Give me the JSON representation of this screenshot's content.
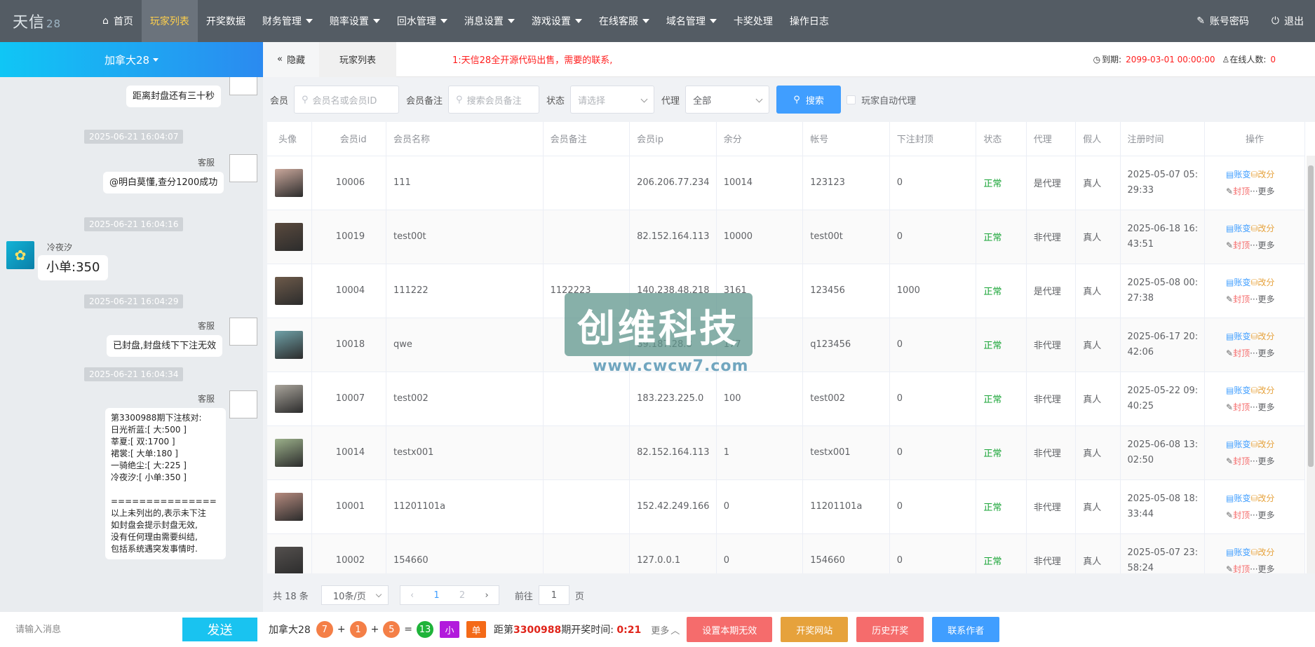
{
  "nav": {
    "logo_main": "天信",
    "logo_num": "28",
    "items": [
      {
        "label": "首页",
        "icon": "home-icon"
      },
      {
        "label": "玩家列表",
        "active": true
      },
      {
        "label": "开奖数据"
      },
      {
        "label": "财务管理",
        "dropdown": true
      },
      {
        "label": "赔率设置",
        "dropdown": true
      },
      {
        "label": "回水管理",
        "dropdown": true
      },
      {
        "label": "消息设置",
        "dropdown": true
      },
      {
        "label": "游戏设置",
        "dropdown": true
      },
      {
        "label": "在线客服",
        "dropdown": true
      },
      {
        "label": "域名管理",
        "dropdown": true
      },
      {
        "label": "卡奖处理"
      },
      {
        "label": "操作日志"
      }
    ],
    "account_label": "账号密码",
    "logout_label": "退出"
  },
  "chat": {
    "room": "加拿大28",
    "messages": [
      {
        "type": "bubble",
        "sender": "",
        "text": "距离封盘还有三十秒"
      },
      {
        "type": "time",
        "text": "2025-06-21 16:04:07"
      },
      {
        "type": "msg",
        "sender": "客服",
        "text": "@明白莫懂,查分1200成功"
      },
      {
        "type": "time",
        "text": "2025-06-21 16:04:16"
      },
      {
        "type": "msg",
        "sender": "冷夜汐",
        "text": "小单:350"
      },
      {
        "type": "time",
        "text": "2025-06-21 16:04:29"
      },
      {
        "type": "msg",
        "sender": "客服",
        "text": "已封盘,封盘线下下注无效"
      },
      {
        "type": "time",
        "text": "2025-06-21 16:04:34"
      },
      {
        "type": "msg",
        "sender": "客服",
        "text": "第3300988期下注核对:\n日光祈蓝:[ 大:500 ]\n莘夏:[ 双:1700 ]\n裙裳:[ 大单:180 ]\n一骑绝尘:[ 大:225 ]\n冷夜汐:[ 小单:350 ]\n\n===============\n以上未列出的,表示未下注\n如封盘会提示封盘无效,\n没有任何理由需要纠结,\n包括系统遇突发事情时."
      }
    ],
    "input_placeholder": "请输入消息",
    "send_label": "发送"
  },
  "tabs": {
    "hide_label": "隐藏",
    "current_tab": "玩家列表",
    "notice": "1:天信28全开源代码出售，需要的联系,",
    "expire_label": "到期:",
    "expire_value": "2099-03-01 00:00:00",
    "online_label": "在线人数:",
    "online_value": "0"
  },
  "filters": {
    "member_label": "会员",
    "member_placeholder": "会员名或会员ID",
    "remark_label": "会员备注",
    "remark_placeholder": "搜索会员备注",
    "status_label": "状态",
    "status_placeholder": "请选择",
    "agent_label": "代理",
    "agent_value": "全部",
    "search_label": "搜索",
    "auto_agent_label": "玩家自动代理"
  },
  "table": {
    "headers": [
      "头像",
      "会员id",
      "会员名称",
      "会员备注",
      "会员ip",
      "余分",
      "帐号",
      "下注封顶",
      "状态",
      "代理",
      "假人",
      "注册时间",
      "操作"
    ],
    "rows": [
      {
        "id": "10006",
        "name": "111",
        "remark": "",
        "ip": "206.206.77.234",
        "balance": "10014",
        "account": "123123",
        "cap": "0",
        "status": "正常",
        "agent": "是代理",
        "fake": "真人",
        "reg1": "2025-05-07 05:",
        "reg2": "29:33",
        "color": "#c9a79b"
      },
      {
        "id": "10019",
        "name": "test00t",
        "remark": "",
        "ip": "82.152.164.113",
        "balance": "10000",
        "account": "test00t",
        "cap": "0",
        "status": "正常",
        "agent": "非代理",
        "fake": "真人",
        "reg1": "2025-06-18 16:",
        "reg2": "43:51",
        "color": "#5a4a3e"
      },
      {
        "id": "10004",
        "name": "111222",
        "remark": "1122223",
        "ip": "140.238.48.218",
        "balance": "3161",
        "account": "123456",
        "cap": "1000",
        "status": "正常",
        "agent": "是代理",
        "fake": "真人",
        "reg1": "2025-05-08 00:",
        "reg2": "27:38",
        "color": "#6d5a4a"
      },
      {
        "id": "10018",
        "name": "qwe",
        "remark": "",
        "ip": "89.187.28.8",
        "balance": "177",
        "account": "q123456",
        "cap": "0",
        "status": "正常",
        "agent": "非代理",
        "fake": "真人",
        "reg1": "2025-06-17 20:",
        "reg2": "42:06",
        "color": "#6fa1a8"
      },
      {
        "id": "10007",
        "name": "test002",
        "remark": "",
        "ip": "183.223.225.0",
        "balance": "100",
        "account": "test002",
        "cap": "0",
        "status": "正常",
        "agent": "非代理",
        "fake": "真人",
        "reg1": "2025-05-22 09:",
        "reg2": "40:25",
        "color": "#a9a49b"
      },
      {
        "id": "10014",
        "name": "testx001",
        "remark": "",
        "ip": "82.152.164.113",
        "balance": "1",
        "account": "testx001",
        "cap": "0",
        "status": "正常",
        "agent": "非代理",
        "fake": "真人",
        "reg1": "2025-06-08 13:",
        "reg2": "02:50",
        "color": "#9bb08a"
      },
      {
        "id": "10001",
        "name": "11201101a",
        "remark": "",
        "ip": "152.42.249.166",
        "balance": "0",
        "account": "11201101a",
        "cap": "0",
        "status": "正常",
        "agent": "非代理",
        "fake": "真人",
        "reg1": "2025-05-08 18:",
        "reg2": "33:44",
        "color": "#b58a7e"
      },
      {
        "id": "10002",
        "name": "154660",
        "remark": "",
        "ip": "127.0.0.1",
        "balance": "0",
        "account": "154660",
        "cap": "0",
        "status": "正常",
        "agent": "非代理",
        "fake": "真人",
        "reg1": "2025-05-07 23:",
        "reg2": "58:24",
        "color": "#54504e"
      }
    ],
    "op_account": "账变",
    "op_score": "改分",
    "op_block": "封顶",
    "op_more": "更多"
  },
  "watermark": {
    "text": "创维科技",
    "url": "www.cwcw7.com"
  },
  "pager": {
    "total": "共 18 条",
    "page_size": "10条/页",
    "current": "1",
    "next_page": "2",
    "goto_label": "前往",
    "goto_value": "1",
    "page_suffix": "页"
  },
  "bottom": {
    "game": "加拿大28",
    "n1": "7",
    "n2": "1",
    "n3": "5",
    "sum": "13",
    "size": "小",
    "parity": "单",
    "prefix": "距第",
    "period": "3300988",
    "suffix": "期开奖时间:",
    "countdown": "0:21",
    "more": "更多",
    "btn_invalid": "设置本期无效",
    "btn_site": "开奖网站",
    "btn_history": "历史开奖",
    "btn_contact": "联系作者",
    "colors": {
      "ball": "#f47f47",
      "sum": "#1fb33a",
      "size": "#b21bdc",
      "parity": "#f46a18",
      "invalid": "#f56c6c",
      "site": "#e6a23c",
      "history": "#f56c6c",
      "contact": "#409eff"
    }
  }
}
